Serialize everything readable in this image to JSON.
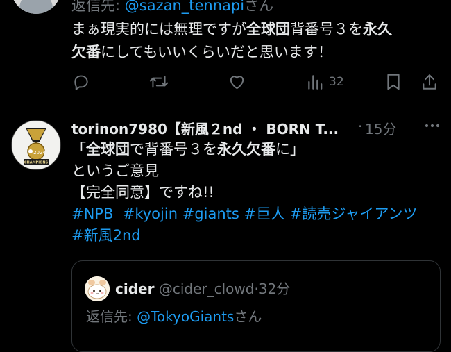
{
  "tweet_a": {
    "reply_prefix": "返信先: ",
    "reply_mention": "@sazan_tennapi",
    "reply_suffix": "さん",
    "body_1": "まぁ現実的には無理ですが",
    "body_2": "全球団",
    "body_3": "背番号３を",
    "body_4": "永久",
    "body_5": "欠番",
    "body_6": "にしてもいいくらいだと思います！",
    "views_count": "32"
  },
  "tweet_b": {
    "author_name": "torinon7980【新風２nd ・ BORN T...",
    "dot": "·",
    "time": "15分",
    "line1_a": "「",
    "line1_b": "全球団",
    "line1_c": "で背番号３を",
    "line1_d": "永久欠番",
    "line1_e": "に」",
    "line2": "というご意見",
    "line3": "【完全同意】ですね!!",
    "hashtags_line1": [
      "#NPB",
      "#kyojin",
      "#giants",
      "#巨人",
      "#読売ジャイアンツ"
    ],
    "hashtags_line2": [
      "#新風2nd"
    ],
    "avatar_badge_text": "2024",
    "avatar_banner_text": "CHAMPIONS",
    "quote": {
      "name": "cider",
      "handle": "@cider_clowd",
      "dot": "·",
      "time": "32分",
      "reply_prefix": "返信先: ",
      "reply_mention": "@TokyoGiants",
      "reply_suffix": "さん"
    }
  },
  "icons": {
    "reply": "reply-icon",
    "retweet": "retweet-icon",
    "like": "heart-icon",
    "views": "views-icon",
    "bookmark": "bookmark-icon",
    "share": "share-icon",
    "more": "more-icon"
  },
  "colors": {
    "background": "#000000",
    "text": "#e7e9ea",
    "muted": "#71767b",
    "link": "#1d9bf0",
    "border": "#2f3336"
  }
}
